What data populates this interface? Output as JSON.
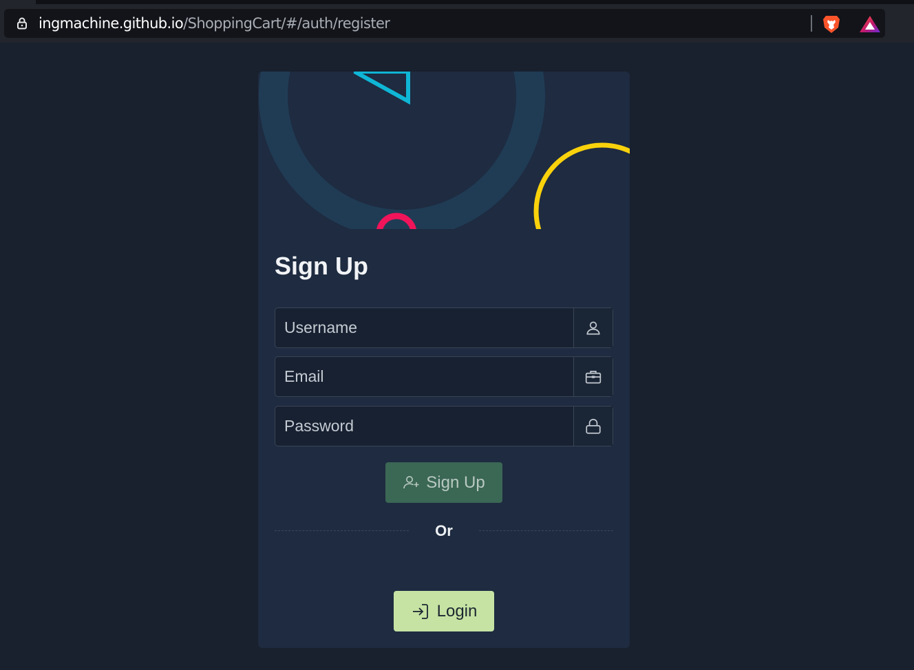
{
  "browser": {
    "url_domain": "ingmachine.github.io",
    "url_path": "/ShoppingCart/#/auth/register",
    "icons": [
      "lock-icon",
      "brave-shield-icon",
      "brave-rewards-icon"
    ]
  },
  "page": {
    "title": "Sign Up",
    "fields": {
      "username": {
        "placeholder": "Username",
        "value": "",
        "icon": "user-icon"
      },
      "email": {
        "placeholder": "Email",
        "value": "",
        "icon": "briefcase-icon"
      },
      "password": {
        "placeholder": "Password",
        "value": "",
        "icon": "lock-icon"
      }
    },
    "signup_button": {
      "label": "Sign Up",
      "icon": "user-plus-icon"
    },
    "divider_text": "Or",
    "login_button": {
      "label": "Login",
      "icon": "sign-in-icon"
    }
  },
  "colors": {
    "background": "#19202e",
    "card": "#1e2b40",
    "signup_button": "#3d6b57",
    "login_button": "#c6e3a4",
    "accent_cyan": "#0fb6d6",
    "accent_pink": "#f0145a",
    "accent_yellow": "#f9d20c"
  }
}
